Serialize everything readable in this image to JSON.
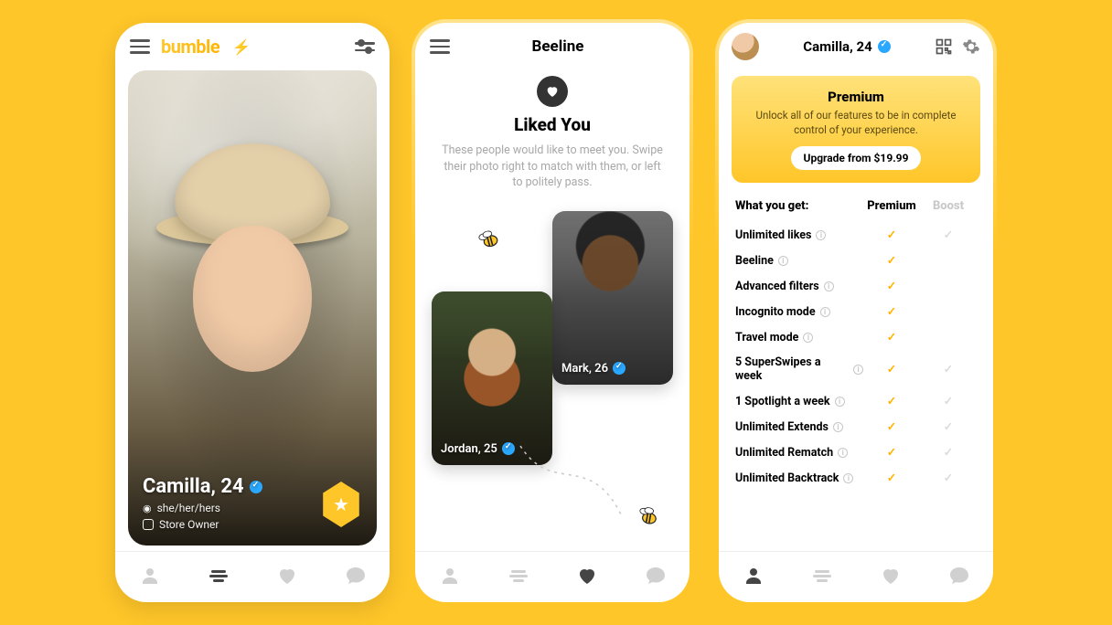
{
  "app": {
    "brand": "bumble"
  },
  "screen1": {
    "profile": {
      "name_line": "Camilla, 24",
      "pronouns": "she/her/hers",
      "occupation": "Store Owner"
    }
  },
  "screen2": {
    "title": "Beeline",
    "heading": "Liked You",
    "subtitle": "These people would like to meet you. Swipe their photo right to match with them, or left to politely pass.",
    "cards": [
      {
        "label": "Jordan, 25"
      },
      {
        "label": "Mark, 26"
      }
    ]
  },
  "screen3": {
    "header_name": "Camilla, 24",
    "premium": {
      "title": "Premium",
      "subtitle": "Unlock all of our features to be in complete control of your experience.",
      "cta": "Upgrade from $19.99"
    },
    "table": {
      "heading": "What you get:",
      "col1": "Premium",
      "col2": "Boost"
    },
    "features": [
      {
        "name": "Unlimited likes",
        "premium": true,
        "boost": true
      },
      {
        "name": "Beeline",
        "premium": true,
        "boost": false
      },
      {
        "name": "Advanced filters",
        "premium": true,
        "boost": false
      },
      {
        "name": "Incognito mode",
        "premium": true,
        "boost": false
      },
      {
        "name": "Travel mode",
        "premium": true,
        "boost": false
      },
      {
        "name": "5 SuperSwipes a week",
        "premium": true,
        "boost": true
      },
      {
        "name": "1 Spotlight a week",
        "premium": true,
        "boost": true
      },
      {
        "name": "Unlimited Extends",
        "premium": true,
        "boost": true
      },
      {
        "name": "Unlimited Rematch",
        "premium": true,
        "boost": true
      },
      {
        "name": "Unlimited Backtrack",
        "premium": true,
        "boost": true
      }
    ]
  }
}
